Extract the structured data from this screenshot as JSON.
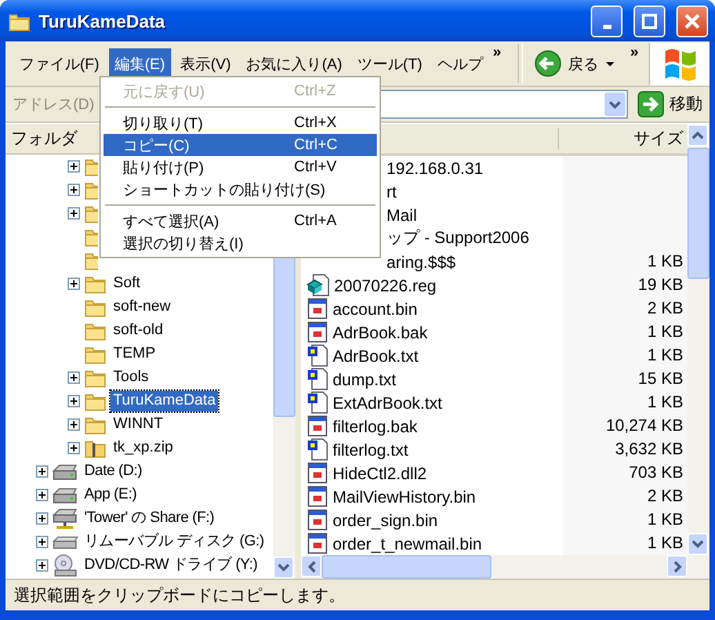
{
  "window": {
    "title": "TuruKameData"
  },
  "menu_bar": {
    "items": [
      {
        "label": "ファイル(F)",
        "selected": false
      },
      {
        "label": "編集(E)",
        "selected": true
      },
      {
        "label": "表示(V)",
        "selected": false
      },
      {
        "label": "お気に入り(A)",
        "selected": false
      },
      {
        "label": "ツール(T)",
        "selected": false
      },
      {
        "label": "ヘルプ",
        "selected": false
      }
    ],
    "overflow": "»"
  },
  "toolbar": {
    "back_button": "戻る",
    "overflow": "»"
  },
  "address_bar": {
    "label": "アドレス(D)",
    "go_button": "移動"
  },
  "folder_pane": {
    "header": "フォルダ",
    "folders": [
      {
        "expandable": true,
        "selected": false,
        "kind": "folder"
      },
      {
        "expandable": true,
        "selected": false,
        "kind": "folder"
      },
      {
        "expandable": true,
        "selected": false,
        "kind": "folder"
      },
      {
        "expandable": false,
        "selected": false,
        "kind": "folder"
      },
      {
        "expandable": false,
        "selected": false,
        "kind": "folder"
      },
      {
        "name": "Soft",
        "expandable": true,
        "selected": false,
        "kind": "folder"
      },
      {
        "name": "soft-new",
        "expandable": false,
        "selected": false,
        "kind": "folder"
      },
      {
        "name": "soft-old",
        "expandable": false,
        "selected": false,
        "kind": "folder"
      },
      {
        "name": "TEMP",
        "expandable": false,
        "selected": false,
        "kind": "folder"
      },
      {
        "name": "Tools",
        "expandable": true,
        "selected": false,
        "kind": "folder"
      },
      {
        "name": "TuruKameData",
        "expandable": true,
        "selected": true,
        "kind": "folder"
      },
      {
        "name": "WINNT",
        "expandable": true,
        "selected": false,
        "kind": "folder"
      },
      {
        "name": "tk_xp.zip",
        "expandable": true,
        "selected": false,
        "kind": "zip"
      }
    ],
    "drives": [
      {
        "name": "Date (D:)",
        "expandable": true,
        "kind": "hdd"
      },
      {
        "name": "App (E:)",
        "expandable": true,
        "kind": "hdd"
      },
      {
        "name": "'Tower' の Share (F:)",
        "expandable": true,
        "kind": "net"
      },
      {
        "name": "リムーバブル ディスク (G:)",
        "expandable": true,
        "kind": "removable"
      },
      {
        "name": "DVD/CD-RW ドライブ (Y:)",
        "expandable": true,
        "kind": "dvd"
      }
    ]
  },
  "file_list": {
    "size_header": "サイズ",
    "rows": [
      {
        "name": "192.168.0.31"
      },
      {
        "name": "rt"
      },
      {
        "name": "Mail"
      },
      {
        "name": "ップ - Support2006"
      },
      {
        "name": "aring.$$$",
        "size": "1 KB"
      },
      {
        "name": "20070226.reg",
        "size": "19 KB",
        "kind": "reg"
      },
      {
        "name": "account.bin",
        "size": "2 KB",
        "kind": "app"
      },
      {
        "name": "AdrBook.bak",
        "size": "1 KB",
        "kind": "app"
      },
      {
        "name": "AdrBook.txt",
        "size": "1 KB",
        "kind": "text"
      },
      {
        "name": "dump.txt",
        "size": "15 KB",
        "kind": "text"
      },
      {
        "name": "ExtAdrBook.txt",
        "size": "1 KB",
        "kind": "text"
      },
      {
        "name": "filterlog.bak",
        "size": "10,274 KB",
        "kind": "app"
      },
      {
        "name": "filterlog.txt",
        "size": "3,632 KB",
        "kind": "text"
      },
      {
        "name": "HideCtl2.dll2",
        "size": "703 KB",
        "kind": "app"
      },
      {
        "name": "MailViewHistory.bin",
        "size": "2 KB",
        "kind": "app"
      },
      {
        "name": "order_sign.bin",
        "size": "1 KB",
        "kind": "app"
      },
      {
        "name": "order_t_newmail.bin",
        "size": "1 KB",
        "kind": "app"
      }
    ]
  },
  "edit_menu": {
    "items": [
      {
        "kind": "item",
        "label": "元に戻す(U)",
        "shortcut": "Ctrl+Z",
        "disabled": true,
        "selected": false
      },
      {
        "kind": "separator"
      },
      {
        "kind": "item",
        "label": "切り取り(T)",
        "shortcut": "Ctrl+X",
        "disabled": false,
        "selected": false
      },
      {
        "kind": "item",
        "label": "コピー(C)",
        "shortcut": "Ctrl+C",
        "disabled": false,
        "selected": true
      },
      {
        "kind": "item",
        "label": "貼り付け(P)",
        "shortcut": "Ctrl+V",
        "disabled": false,
        "selected": false
      },
      {
        "kind": "item",
        "label": "ショートカットの貼り付け(S)",
        "disabled": false,
        "selected": false
      },
      {
        "kind": "separator"
      },
      {
        "kind": "item",
        "label": "すべて選択(A)",
        "shortcut": "Ctrl+A",
        "disabled": false,
        "selected": false
      },
      {
        "kind": "item",
        "label": "選択の切り替え(I)",
        "disabled": false,
        "selected": false
      }
    ]
  },
  "status_bar": {
    "text": "選択範囲をクリップボードにコピーします。"
  }
}
